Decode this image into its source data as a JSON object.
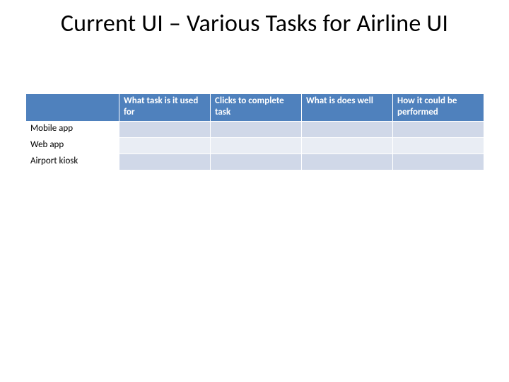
{
  "title": "Current UI – Various Tasks for Airline UI",
  "table": {
    "columns": [
      "What task is it used for",
      "Clicks to complete task",
      "What is does well",
      "How it could be performed"
    ],
    "rows": [
      {
        "label": "Mobile app",
        "cells": [
          "",
          "",
          "",
          ""
        ]
      },
      {
        "label": "Web app",
        "cells": [
          "",
          "",
          "",
          ""
        ]
      },
      {
        "label": "Airport kiosk",
        "cells": [
          "",
          "",
          "",
          ""
        ]
      }
    ]
  }
}
